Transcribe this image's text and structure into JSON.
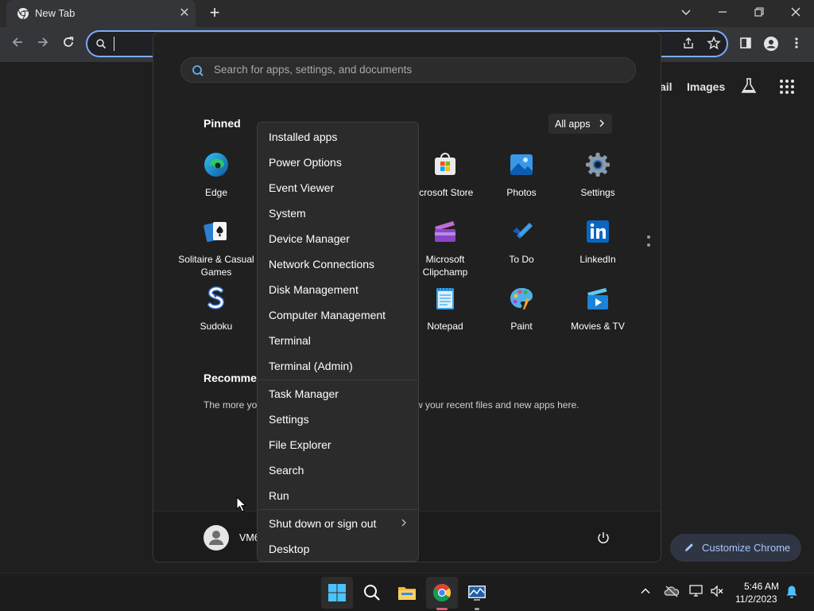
{
  "browser": {
    "tab_title": "New Tab",
    "tab_close_glyph": "✕",
    "new_tab_glyph": "+",
    "ntp_links": [
      "ail",
      "Images"
    ]
  },
  "customize_chrome": {
    "label": "Customize Chrome"
  },
  "start_menu": {
    "search_placeholder": "Search for apps, settings, and documents",
    "pinned_title": "Pinned",
    "all_apps_label": "All apps",
    "recommended_title": "Recommen",
    "recommended_msg_left": "The more yo",
    "recommended_msg_right": "w your recent files and new apps here.",
    "pinned_apps": [
      {
        "label": "Edge",
        "icon": "edge-icon"
      },
      {
        "label": "icrosoft Store",
        "icon": "microsoft-store-icon"
      },
      {
        "label": "Photos",
        "icon": "photos-icon"
      },
      {
        "label": "Settings",
        "icon": "settings-gear-icon"
      },
      {
        "label": "Solitaire & Casual Games",
        "icon": "solitaire-icon"
      },
      {
        "label": "Microsoft Clipchamp",
        "icon": "clipchamp-icon"
      },
      {
        "label": "To Do",
        "icon": "todo-icon"
      },
      {
        "label": "LinkedIn",
        "icon": "linkedin-icon"
      },
      {
        "label": "Sudoku",
        "icon": "sudoku-icon"
      },
      {
        "label": "Notepad",
        "icon": "notepad-icon"
      },
      {
        "label": "Paint",
        "icon": "paint-icon"
      },
      {
        "label": "Movies & TV",
        "icon": "movies-tv-icon"
      }
    ],
    "user_name": "VM6"
  },
  "context_menu": {
    "items": [
      "Installed apps",
      "Power Options",
      "Event Viewer",
      "System",
      "Device Manager",
      "Network Connections",
      "Disk Management",
      "Computer Management",
      "Terminal",
      "Terminal (Admin)",
      "Task Manager",
      "Settings",
      "File Explorer",
      "Search",
      "Run",
      "Shut down or sign out",
      "Desktop"
    ]
  },
  "taskbar": {
    "time": "5:46 AM",
    "date": "11/2/2023"
  },
  "colors": {
    "accent_blue": "#7cacf8",
    "chrome_active_indicator": "#e25c76",
    "notification_bell": "#4cc2ff"
  }
}
